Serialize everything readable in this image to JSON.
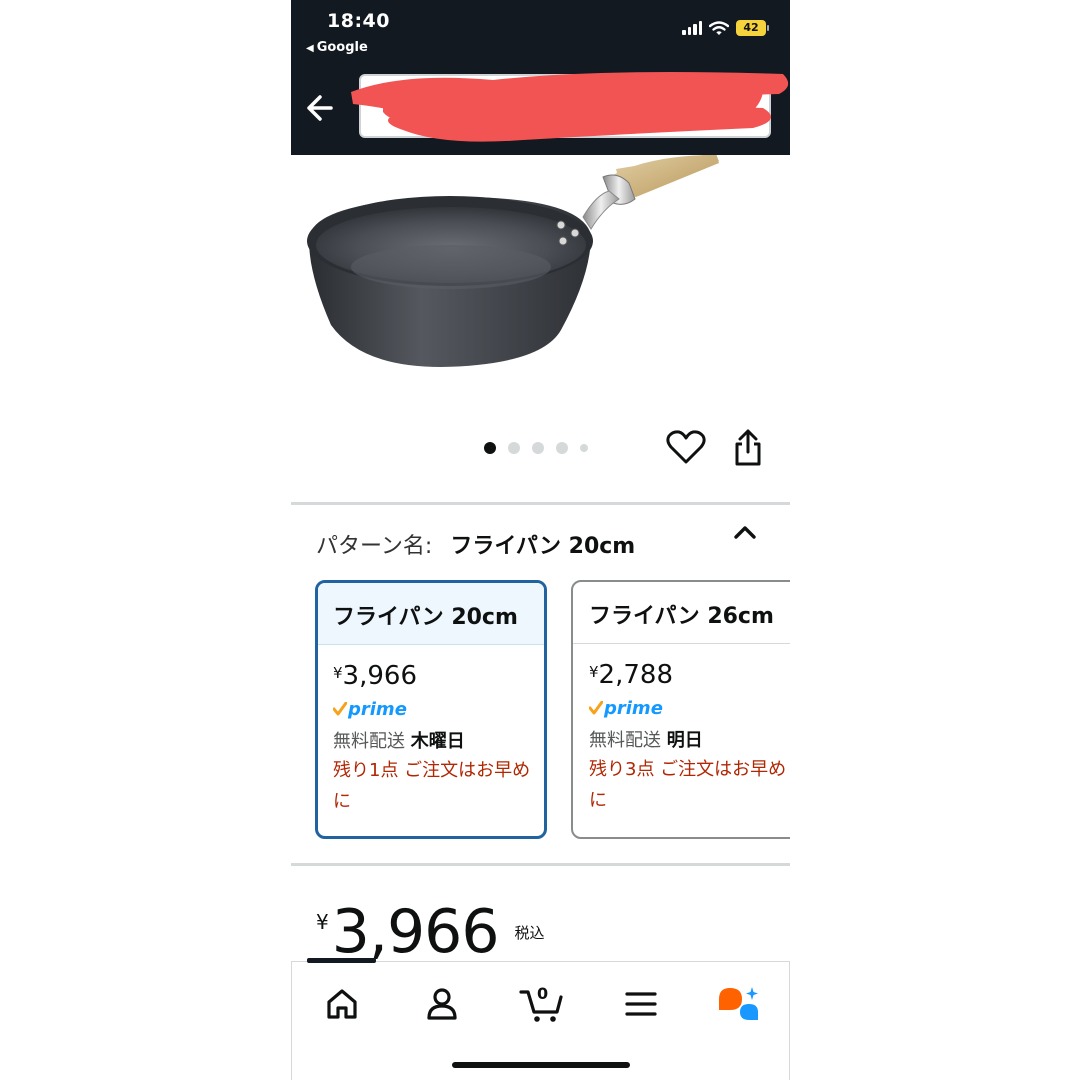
{
  "status_bar": {
    "time": "18:40",
    "back_app": "Google",
    "battery": "42"
  },
  "pattern": {
    "label": "パターン名:",
    "value": "フライパン 20cm"
  },
  "options": [
    {
      "name": "フライパン 20cm",
      "price_symbol": "¥",
      "price": "3,966",
      "prime": "prime",
      "ship_label": "無料配送",
      "ship_day": "木曜日",
      "stock": "残り1点 ご注文はお早めに",
      "selected": true
    },
    {
      "name": "フライパン 26cm",
      "price_symbol": "¥",
      "price": "2,788",
      "prime": "prime",
      "ship_label": "無料配送",
      "ship_day": "明日",
      "stock": "残り3点 ご注文はお早めに",
      "selected": false
    }
  ],
  "price": {
    "symbol": "¥",
    "value": "3,966",
    "tax": "税込"
  },
  "image_carousel": {
    "count": 5,
    "current": 1
  },
  "cart": {
    "count": "0"
  },
  "colors": {
    "header": "#131921",
    "selected_border": "#2162a1",
    "stock_red": "#b12704",
    "prime_blue": "#1399ff",
    "prime_check": "#f7a21b"
  }
}
